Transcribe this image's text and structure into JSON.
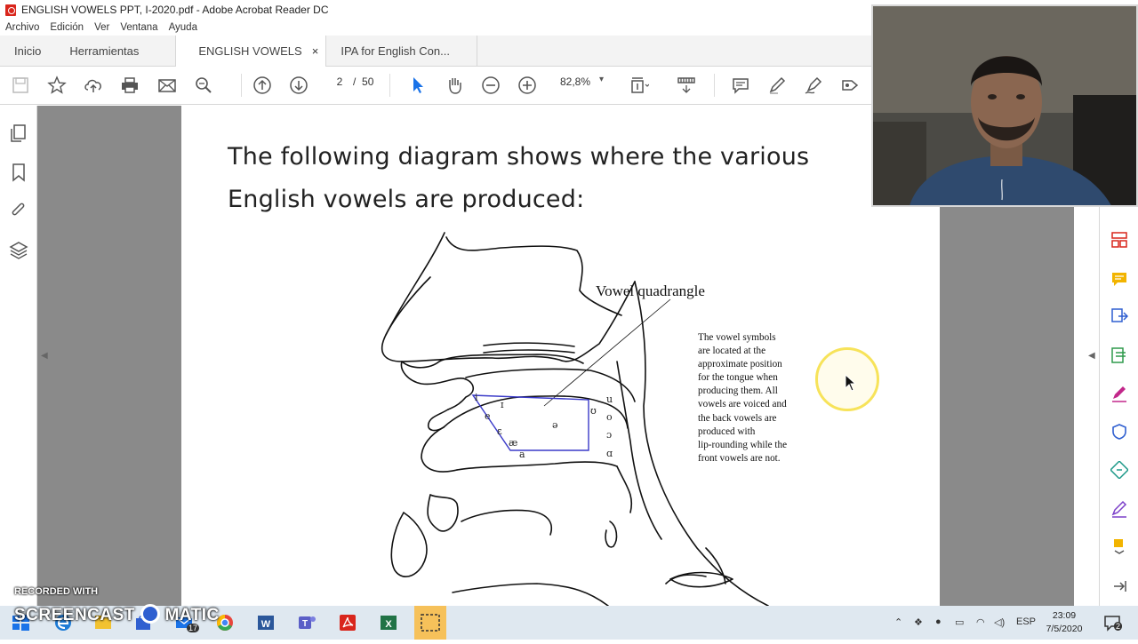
{
  "window": {
    "title": "ENGLISH VOWELS PPT, I-2020.pdf - Adobe Acrobat Reader DC"
  },
  "menu": [
    "Archivo",
    "Edición",
    "Ver",
    "Ventana",
    "Ayuda"
  ],
  "tabs": {
    "home": "Inicio",
    "tools": "Herramientas",
    "doc1": "ENGLISH VOWELS ...",
    "doc1_close": "×",
    "doc2": "IPA for English Con..."
  },
  "toolbar": {
    "page_current": "2",
    "page_separator": "/",
    "page_total": "50",
    "zoom": "82,8%"
  },
  "document": {
    "heading_line1": "The following diagram shows where the various",
    "heading_line2": "English vowels are produced:",
    "diagram_label": "Vowel quadrangle",
    "caption_lines": [
      "The vowel symbols",
      "are located at the",
      "approximate position",
      "for the tongue when",
      "producing them. All",
      "vowels are voiced and",
      "the back vowels are",
      "produced with",
      "lip-rounding while the",
      "front vowels are not."
    ],
    "vowels": {
      "i": "i",
      "ih": "ɪ",
      "e": "e",
      "eh": "ɛ",
      "ae": "æ",
      "a": "a",
      "schwa": "ə",
      "u": "u",
      "uh": "ʊ",
      "o": "o",
      "oh": "ɔ",
      "ah": "ɑ"
    }
  },
  "taskbar": {
    "recorded_with": "RECORDED WITH",
    "screencast": "SCREENCAST",
    "matic": "MATIC",
    "badge": "17",
    "language": "ESP",
    "time": "23:09",
    "date": "7/5/2020",
    "notifications": "2"
  },
  "colors": {
    "quadrangle": "#3a3ac8",
    "cursor_ring": "#f7e35a",
    "pdf_red": "#d9261c",
    "cursor_blue": "#1a73e8"
  }
}
